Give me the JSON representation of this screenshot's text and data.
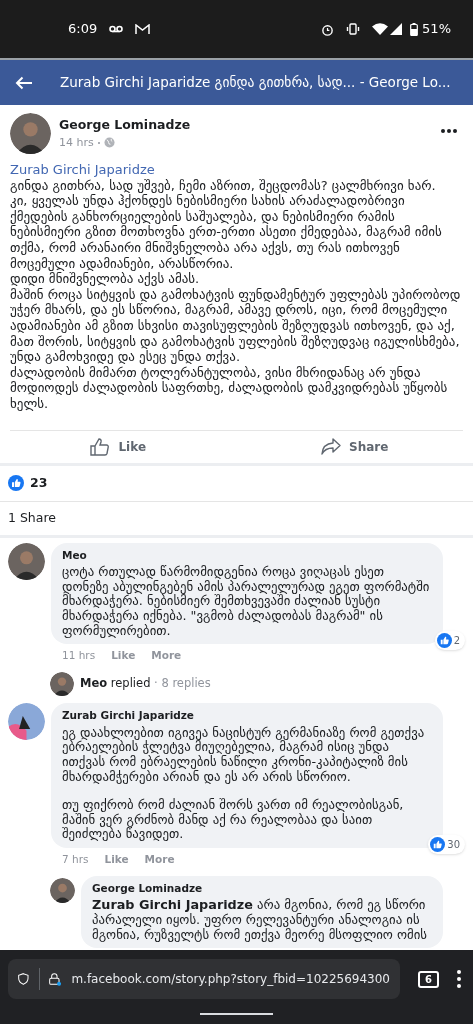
{
  "status_bar": {
    "time": "6:09",
    "battery": "51%"
  },
  "header": {
    "title": "Zurab Girchi Japaridze გინდა გითხრა, სად... - George Lo..."
  },
  "post": {
    "author": "George Lominadze",
    "time": "14 hrs",
    "mention": "Zurab Girchi Japaridze",
    "paragraphs": [
      "გინდა გითხრა, სად უშვებ, ჩემი აზრით, შეცდომას? ცალმხრივი ხარ.",
      "კი, ყველას უნდა ჰქონდეს ნებისმიერი სახის არაძალადობრივი ქმედების განხორციელების საშუალება, და ნებისმიერი რამის ნებისმიერი გზით მოთხოვნა ერთ-ერთი ასეთი ქმედებაა, მაგრამ იმის თქმა, რომ არანაირი მნიშვნელობა არა აქვს, თუ რას ითხოვენ მოცემული ადამიანები, არასწორია.",
      "დიდი მნიშვნელობა აქვს ამას.",
      "მაშინ როცა სიტყვის და გამოხატვის ფუნდამენტურ უფლებას უპირობოდ უჭერ მხარს, და ეს სწორია, მაგრამ, ამავე დროს, იცი, რომ მოცემული ადამიანები ამ გზით სხვისი თავისუფლების შეზღუდვას ითხოვენ, და აქ, მათ შორის, სიტყვის და გამოხატვის უფლების შეზღუდვაც იგულისხმება, უნდა გამოხვიდე და ესეც უნდა თქვა.",
      "ძალადობის მიმართ ტოლერანტულობა, ვისი მხრიდანაც არ უნდა მოდიოდეს ძალადობის საფრთხე, ძალადობის დამკვიდრებას უწყობს ხელს."
    ],
    "actions": [
      "Like",
      "Share"
    ],
    "likes": "23",
    "shares": "1 Share"
  },
  "comments": [
    {
      "kind": "comment",
      "author": "Meo",
      "paragraphs": [
        "ცოტა რთულად წარმომიდგენია როცა ვიღაცას ესეთ დონეზე აბულინგებენ ამის პარალელურად ეგეთ ფორმატში მხარდაჭერა. ნებისმიერ შემთხვევაში ძალიან სუსტი მხარდაჭერა იქნება. \"ვგმობ ძალადობას მაგრამ\" ის ფორმულირებით."
      ],
      "reactions": "2",
      "time": "11 hrs",
      "links": [
        "Like",
        "More"
      ]
    },
    {
      "kind": "replies",
      "author": "Meo",
      "verb": "replied",
      "separator": "·",
      "count": "8 replies"
    },
    {
      "kind": "comment",
      "author": "Zurab Girchi Japaridze",
      "paragraphs": [
        "ეგ დაახლოებით იგივეა ნაცისტურ გერმანიაზე რომ გეთქვა ებრაელების ჭლეტვა მიუღებელია, მაგრამ ისიც უნდა ითქვას რომ ებრაელების ნაწილი კრონი-კაპიტალიზ მის მხარდამჭერები არიან და ეს არ არის სწორიო.",
        "თუ ფიქრობ რომ ძალიან შორს ვართ იმ რეალობისგან, მაშინ ვერ გრძნობ მანდ აქ რა რეალობაა და საით შეიძლება წავიდეთ."
      ],
      "reactions": "30",
      "time": "7 hrs",
      "links": [
        "Like",
        "More"
      ]
    },
    {
      "kind": "reply",
      "author": "George Lominadze",
      "paragraphs": [
        "**Zurab Girchi Japaridze** არა მგონია, რომ ეგ სწორი პარალელი იყოს. უფრო რელევანტური ანალოგია ის მგონია, რუზველტს რომ ეთქვა მეორე მსოფლიო ომის"
      ]
    }
  ],
  "browser": {
    "url": "m.facebook.com/story.php?story_fbid=10225694300",
    "tabs": "6"
  }
}
